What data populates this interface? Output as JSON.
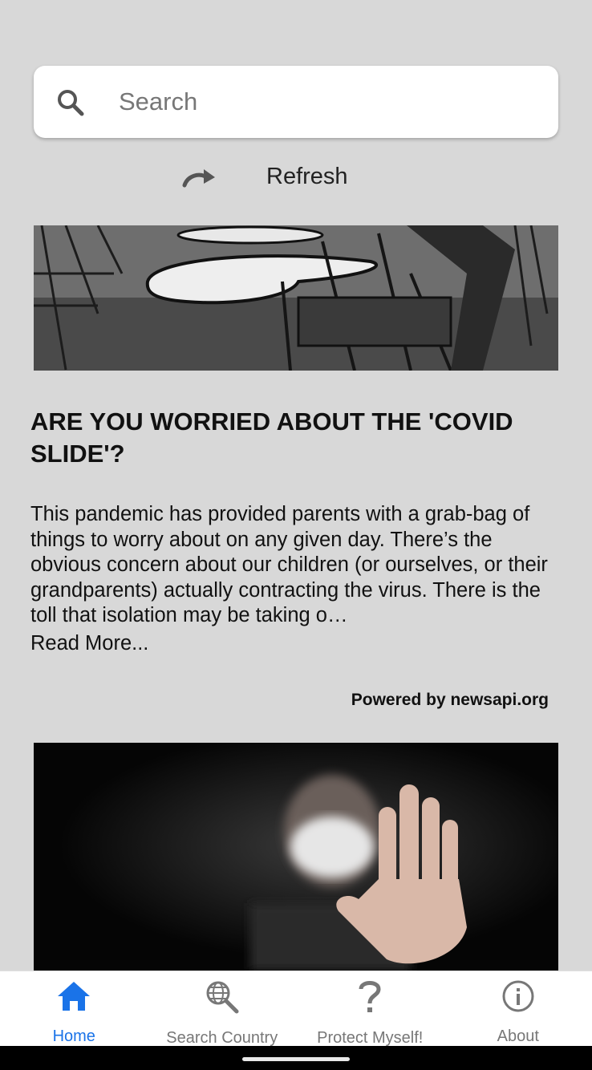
{
  "search": {
    "placeholder": "Search"
  },
  "refresh": {
    "label": "Refresh"
  },
  "articles": [
    {
      "title": "ARE YOU WORRIED ABOUT THE 'COVID SLIDE'?",
      "description": "This pandemic has provided parents with a grab-bag of things to worry about on any given day. There’s the obvious concern about our children (or ourselves, or their grandparents) actually contracting the virus. There is the toll that isolation may be taking o…",
      "read_more": "Read More...",
      "powered_by": "Powered by newsapi.org"
    }
  ],
  "tabs": [
    {
      "label": "Home",
      "icon": "home-icon",
      "active": true
    },
    {
      "label": "Search Country",
      "icon": "globe-search-icon",
      "active": false
    },
    {
      "label": "Protect Myself!",
      "icon": "question-icon",
      "active": false
    },
    {
      "label": "About",
      "icon": "info-icon",
      "active": false
    }
  ],
  "colors": {
    "accent": "#1a73e8",
    "background": "#d8d8d8",
    "inactive": "#777777"
  }
}
